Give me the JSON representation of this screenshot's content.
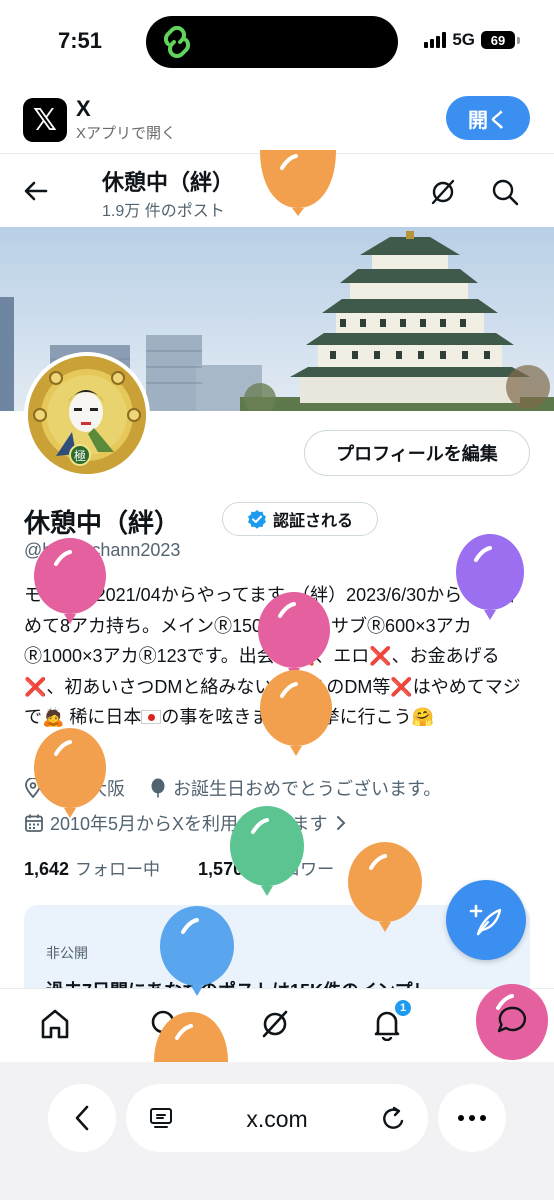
{
  "status_bar": {
    "time": "7:51",
    "network": "5G",
    "battery": "69"
  },
  "app_banner": {
    "name": "X",
    "subtitle": "Xアプリで開く",
    "open_label": "開く"
  },
  "header": {
    "name": "休憩中（絆）",
    "post_count": "1.9万 件のポスト"
  },
  "profile": {
    "display_name": "休憩中（絆）",
    "verify_label": "認証される",
    "handle": "@hhayachann2023",
    "edit_label": "プロフィールを編集",
    "bio_1": "モンスト2021/04からやってます。（絆）2023/6/30からサブ含めて8アカ持ち。メインⓇ1500超え、 サブⓇ600×3アカⓇ1000×3アカⓇ123です。出会い❌、エロ❌、お金あげる❌、初あいさつDMと絡みない方からのDM等❌はやめてマジで🙇 稀に日本",
    "bio_2": "の事を呟きます。選挙に行こう🤗",
    "location": "日本 大阪",
    "birthday": "お誕生日おめでとうございます。",
    "joined": "2010年5月からXを利用しています",
    "following_count": "1,642",
    "following_label": "フォロー中",
    "followers_count": "1,570",
    "followers_label": "フォロワー"
  },
  "private_card": {
    "label": "非公開",
    "text": "過去7日間にあなたのポストは15K件のインプレ"
  },
  "nav": {
    "notification_badge": "1"
  },
  "browser": {
    "url": "x.com"
  },
  "colors": {
    "accent": "#3b8ff0",
    "verified": "#1d9bf0",
    "balloon_orange": "#f2a04d",
    "balloon_pink": "#e5609f",
    "balloon_purple": "#9c6ef0",
    "balloon_green": "#5cc490",
    "balloon_blue": "#5aa6ee"
  }
}
